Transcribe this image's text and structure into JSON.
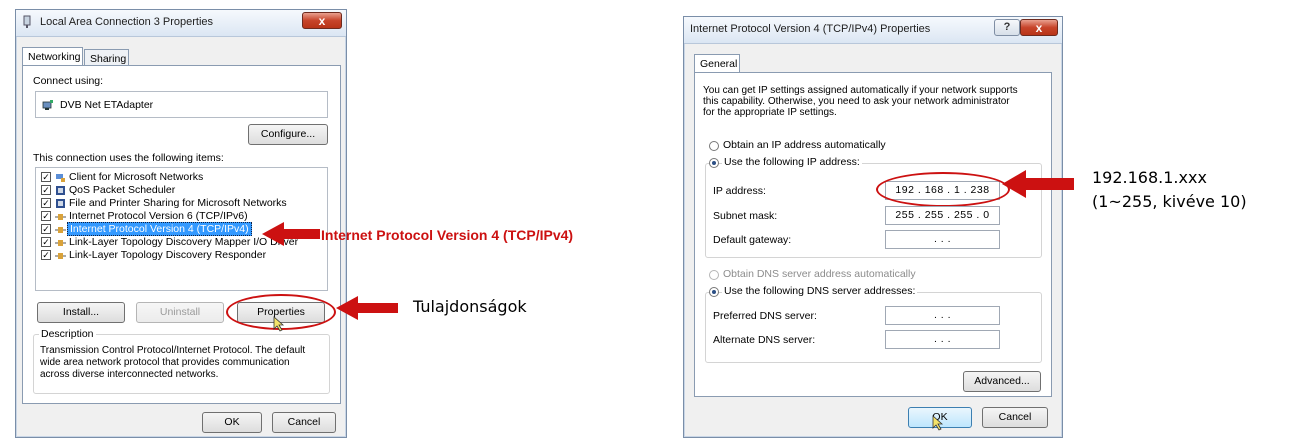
{
  "left_dialog": {
    "title": "Local Area Connection 3 Properties",
    "close_label": "x",
    "tabs": [
      {
        "label": "Networking"
      },
      {
        "label": "Sharing"
      }
    ],
    "connect_using_label": "Connect using:",
    "adapter_name": "DVB Net ETAdapter",
    "configure_label": "Configure...",
    "items_label": "This connection uses the following items:",
    "items": [
      {
        "label": "Client for Microsoft Networks",
        "checked": true
      },
      {
        "label": "QoS Packet Scheduler",
        "checked": true
      },
      {
        "label": "File and Printer Sharing for Microsoft Networks",
        "checked": true
      },
      {
        "label": "Internet Protocol Version 6 (TCP/IPv6)",
        "checked": true
      },
      {
        "label": "Internet Protocol Version 4 (TCP/IPv4)",
        "checked": true
      },
      {
        "label": "Link-Layer Topology Discovery Mapper I/O Driver",
        "checked": true
      },
      {
        "label": "Link-Layer Topology Discovery Responder",
        "checked": true
      }
    ],
    "install_label": "Install...",
    "uninstall_label": "Uninstall",
    "properties_label": "Properties",
    "description_label": "Description",
    "description_lines": [
      "Transmission Control Protocol/Internet Protocol. The default",
      "wide area network protocol that provides communication",
      "across diverse interconnected networks."
    ],
    "ok_label": "OK",
    "cancel_label": "Cancel"
  },
  "right_dialog": {
    "title": "Internet Protocol Version 4 (TCP/IPv4) Properties",
    "help_label": "?",
    "close_label": "x",
    "tab_label": "General",
    "intro_lines": [
      "You can get IP settings assigned automatically if your network supports",
      "this capability. Otherwise, you need to ask your network administrator",
      "for the appropriate IP settings."
    ],
    "obtain_ip_label": "Obtain an IP address automatically",
    "use_ip_label": "Use the following IP address:",
    "ip_address_label": "IP address:",
    "ip_address_value": "192 . 168 .  1  . 238",
    "subnet_label": "Subnet mask:",
    "subnet_value": "255 . 255 . 255 .  0",
    "gateway_label": "Default gateway:",
    "gateway_value": ".      .      .",
    "obtain_dns_label": "Obtain DNS server address automatically",
    "use_dns_label": "Use the following DNS server addresses:",
    "preferred_dns_label": "Preferred DNS server:",
    "preferred_dns_value": ".      .      .",
    "alternate_dns_label": "Alternate DNS server:",
    "alternate_dns_value": ".      .      .",
    "advanced_label": "Advanced...",
    "ok_label": "OK",
    "cancel_label": "Cancel"
  },
  "annotations": {
    "ipv4_callout": "Internet Protocol Version 4 (TCP/IPv4)",
    "properties_callout": "Tulajdonságok",
    "ip_callout_line1": "192.168.1.xxx",
    "ip_callout_line2": "(1~255, kivéve 10)",
    "accent_color": "#cc1111"
  }
}
